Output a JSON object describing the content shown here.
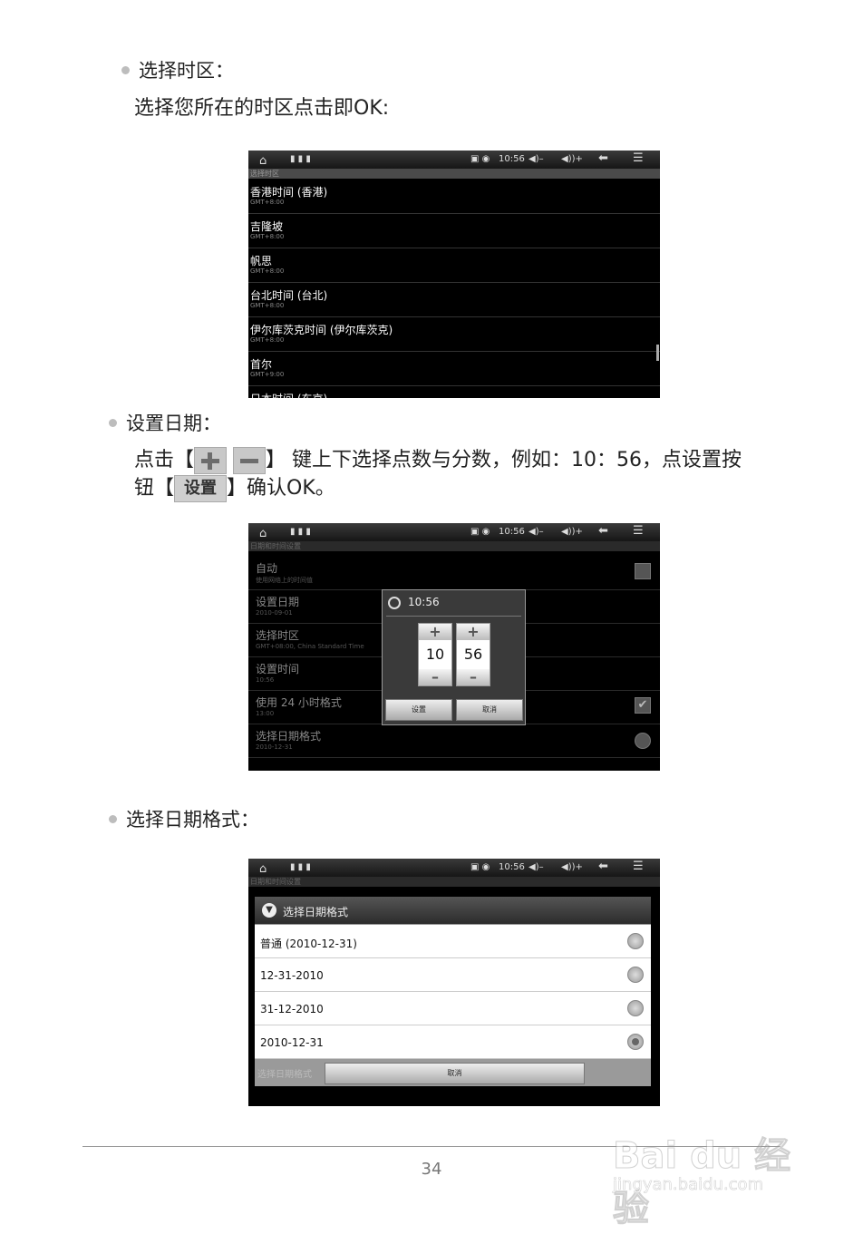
{
  "section1": {
    "heading": "选择时区：",
    "text": "选择您所在的时区点击即OK:"
  },
  "status_bar": {
    "time": "10:56",
    "vol_down": "◀)–",
    "vol_up": "◀))+",
    "back_icon": "back-arrow-icon",
    "menu_icon": "menu-icon"
  },
  "screen1": {
    "title": "选择时区",
    "items": [
      {
        "name": "香港时间 (香港)",
        "sub": "GMT+8:00"
      },
      {
        "name": "吉隆坡",
        "sub": "GMT+8:00"
      },
      {
        "name": "帆思",
        "sub": "GMT+8:00"
      },
      {
        "name": "台北时间 (台北)",
        "sub": "GMT+8:00"
      },
      {
        "name": "伊尔库茨克时间 (伊尔库茨克)",
        "sub": "GMT+8:00"
      },
      {
        "name": "首尔",
        "sub": "GMT+9:00"
      },
      {
        "name": "日本时间 (东京)",
        "sub": ""
      }
    ]
  },
  "section2": {
    "heading": "设置日期：",
    "text_a": "点击【",
    "text_b": "】 键上下选择点数与分数，例如：10：56，点设置按",
    "text_c": "钮【",
    "set_label": "设置",
    "text_d": "】确认OK。"
  },
  "screen2": {
    "title": "日期和时间设置",
    "rows": [
      {
        "name": "自动",
        "sub": "使用网络上的时间值"
      },
      {
        "name": "设置日期",
        "sub": "2010-09-01"
      },
      {
        "name": "选择时区",
        "sub": "GMT+08:00, China Standard Time"
      },
      {
        "name": "设置时间",
        "sub": "10:56"
      },
      {
        "name": "使用 24 小时格式",
        "sub": "13:00"
      },
      {
        "name": "选择日期格式",
        "sub": "2010-12-31"
      }
    ],
    "dialog": {
      "title": "10:56",
      "hour": "10",
      "minute": "56",
      "plus": "+",
      "minus": "–",
      "set_btn": "设置",
      "cancel_btn": "取消"
    }
  },
  "section3": {
    "heading": "选择日期格式："
  },
  "screen3": {
    "title": "日期和时间设置",
    "dialog_title": "选择日期格式",
    "options": [
      "普通 (2010-12-31)",
      "12-31-2010",
      "31-12-2010",
      "2010-12-31"
    ],
    "selected_index": 3,
    "cancel_btn": "取消",
    "behind_row": "选择日期格式"
  },
  "page_number": "34",
  "watermark": {
    "brand": "Bai du 经验",
    "url": "jingyan.baidu.com"
  }
}
